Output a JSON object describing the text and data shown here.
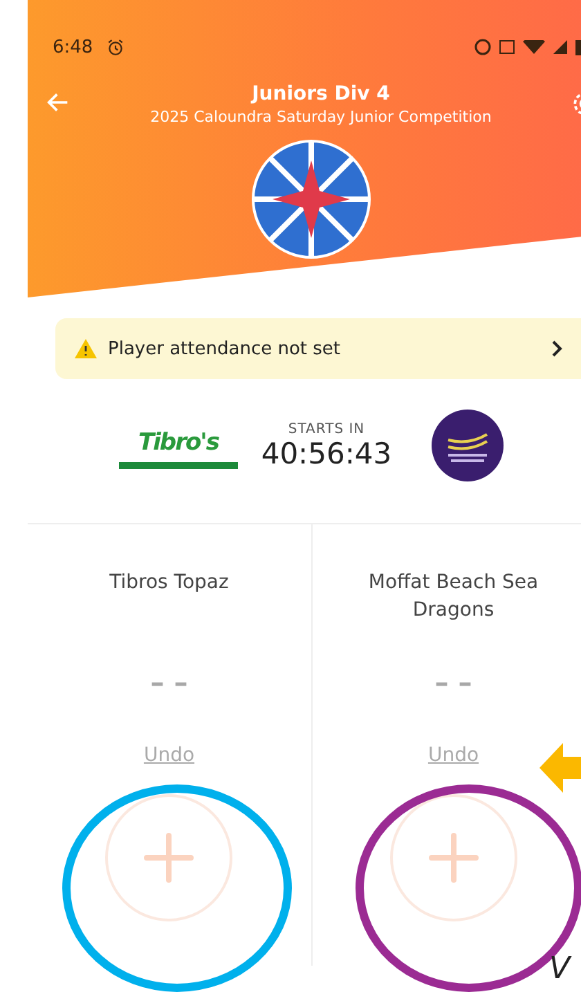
{
  "status_bar": {
    "time": "6:48"
  },
  "header": {
    "title": "Juniors Div 4",
    "subtitle": "2025 Caloundra Saturday Junior Competition"
  },
  "alert": {
    "text": "Player attendance not set"
  },
  "match": {
    "home_logo_text": "Tibro's",
    "countdown_label": "STARTS IN",
    "countdown": "40:56:43"
  },
  "teams": [
    {
      "name": "Tibros Topaz",
      "score": "– –",
      "undo": "Undo"
    },
    {
      "name": "Moffat Beach Sea Dragons",
      "score": "– –",
      "undo": "Undo"
    }
  ],
  "annotations": [
    {
      "kind": "circle",
      "color": "#00b0ec"
    },
    {
      "kind": "circle",
      "color": "#9b2b93"
    },
    {
      "kind": "arrow",
      "color": "#fbb800"
    },
    {
      "kind": "text",
      "text": "V"
    }
  ]
}
